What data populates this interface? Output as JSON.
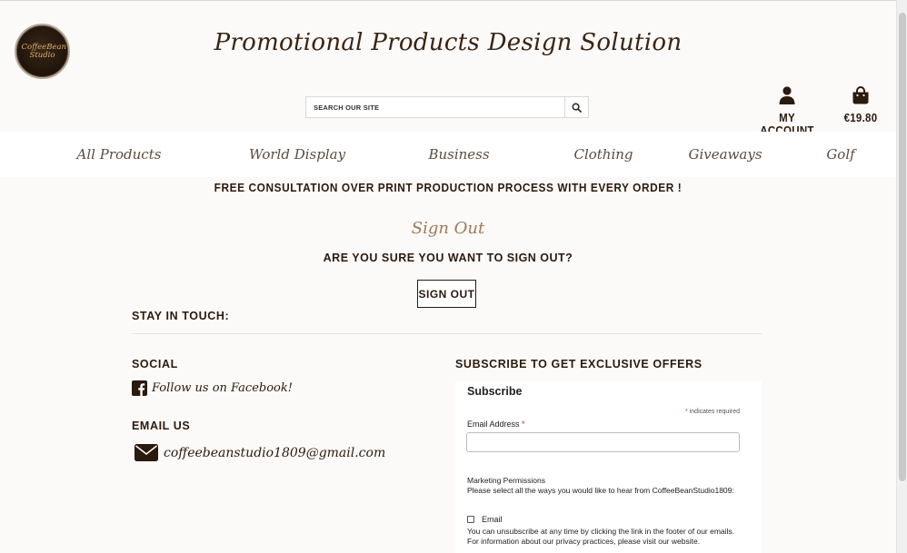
{
  "header": {
    "logo_text": "CoffeeBean Studio",
    "site_title": "Promotional Products Design Solution",
    "search_placeholder": "SEARCH OUR SITE",
    "account_label": "MY ACCOUNT",
    "cart_total": "€19.80"
  },
  "nav": {
    "items": [
      "All Products",
      "World Display",
      "Business",
      "Clothing",
      "Giveaways",
      "Golf"
    ]
  },
  "banner": "FREE CONSULTATION OVER PRINT PRODUCTION PROCESS WITH EVERY ORDER !",
  "signout": {
    "title": "Sign Out",
    "question": "ARE YOU SURE YOU WANT TO SIGN OUT?",
    "button": "SIGN OUT"
  },
  "footer": {
    "stay_in_touch": "STAY IN TOUCH:",
    "social_heading": "SOCIAL",
    "facebook_text": "Follow us on Facebook!",
    "email_heading": "EMAIL US",
    "email_address": "coffeebeanstudio1809@gmail.com",
    "subscribe_heading": "SUBSCRIBE TO GET EXCLUSIVE OFFERS"
  },
  "subscribe_form": {
    "title": "Subscribe",
    "required_note": "indicates required",
    "required_mark": "*",
    "email_label": "Email Address",
    "marketing_title": "Marketing Permissions",
    "marketing_text": "Please select all the ways you would like to hear from CoffeeBeanStudio1809:",
    "checkbox_label": "Email",
    "unsubscribe_text": "You can unsubscribe at any time by clicking the link in the footer of our emails. For information about our privacy practices, please visit our website."
  },
  "colors": {
    "background": "#fcfaf8",
    "text_dark": "#2b1a0e",
    "accent_brown": "#9c7a58",
    "nav_bg": "#ffffff"
  }
}
